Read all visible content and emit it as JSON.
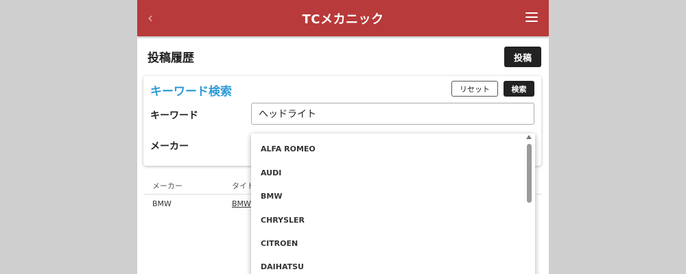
{
  "header": {
    "title": "TCメカニック",
    "back_icon": "chevron-left-icon",
    "menu_icon": "hamburger-menu-icon"
  },
  "page": {
    "title": "投稿履歴",
    "post_button_label": "投稿"
  },
  "search": {
    "heading": "キーワード検索",
    "reset_label": "リセット",
    "search_label": "検索",
    "keyword_label": "キーワード",
    "keyword_value": "ヘッドライト",
    "maker_label": "メーカー"
  },
  "results": {
    "columns": [
      "メーカー",
      "タイト"
    ],
    "rows": [
      {
        "maker": "BMW",
        "title": "BMW"
      }
    ]
  },
  "maker_dropdown": {
    "options": [
      "ALFA ROMEO",
      "AUDI",
      "BMW",
      "CHRYSLER",
      "CITROEN",
      "DAIHATSU"
    ]
  },
  "colors": {
    "header": "#b83a3a",
    "accent": "#2e9ad8",
    "dark_button": "#222222",
    "background": "#cfcfcf"
  }
}
